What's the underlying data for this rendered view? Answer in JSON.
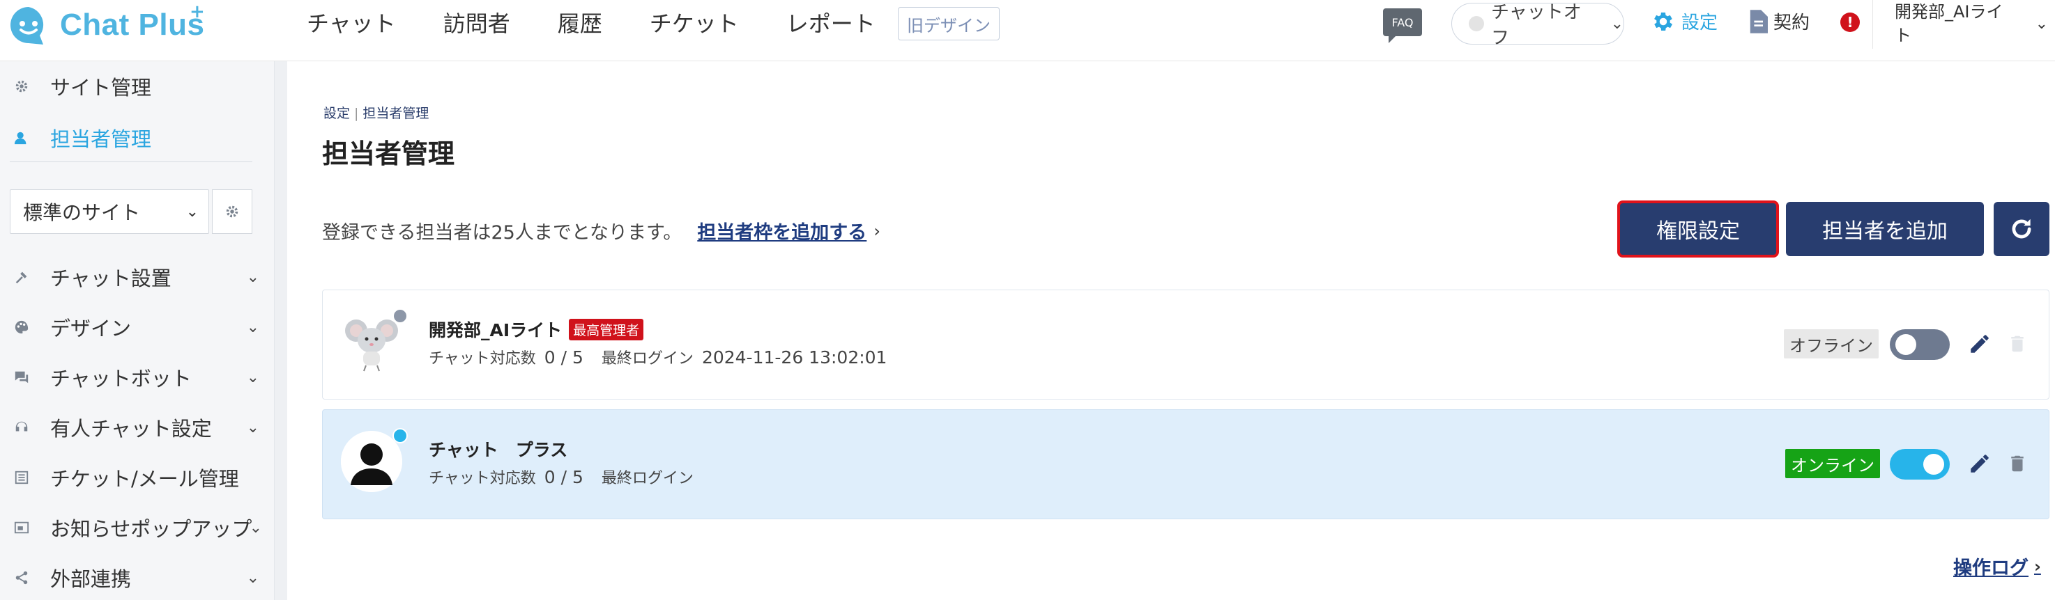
{
  "header": {
    "brand": "Chat Plus",
    "brand_sup": "+",
    "nav": [
      "チャット",
      "訪問者",
      "履歴",
      "チケット",
      "レポート"
    ],
    "old_design": "旧デザイン",
    "faq": "FAQ",
    "chat_status": "チャットオフ",
    "settings": "設定",
    "contract": "契約",
    "alert": "!",
    "user_line1": "開発部_AIライ",
    "user_line2": "ト"
  },
  "sidebar": {
    "top_items": [
      {
        "label": "サイト管理",
        "icon": "gear-icon"
      },
      {
        "label": "担当者管理",
        "icon": "person-icon"
      }
    ],
    "site_select": "標準のサイト",
    "menu": [
      {
        "label": "チャット設置",
        "icon": "tools-icon"
      },
      {
        "label": "デザイン",
        "icon": "palette-icon"
      },
      {
        "label": "チャットボット",
        "icon": "chat-bubbles-icon"
      },
      {
        "label": "有人チャット設定",
        "icon": "headset-icon"
      },
      {
        "label": "チケット/メール管理",
        "icon": "list-icon"
      },
      {
        "label": "お知らせポップアップ",
        "icon": "popup-icon"
      },
      {
        "label": "外部連携",
        "icon": "share-icon"
      }
    ]
  },
  "main": {
    "breadcrumb": [
      "設定",
      "担当者管理"
    ],
    "title": "担当者管理",
    "limit_text": "登録できる担当者は25人までとなります。",
    "add_slot_link": "担当者枠を追加する",
    "perm_button": "権限設定",
    "add_button": "担当者を追加",
    "operators": [
      {
        "name": "開発部_AIライト",
        "role": "最高管理者",
        "chat_label": "チャット対応数",
        "chat_count": "0 / 5",
        "login_label": "最終ログイン",
        "login_time": "2024-11-26 13:02:01",
        "status": "オフライン",
        "dot_color": "#8d97a8"
      },
      {
        "name": "チャット　プラス",
        "role": "",
        "chat_label": "チャット対応数",
        "chat_count": "0 / 5",
        "login_label": "最終ログイン",
        "login_time": "",
        "status": "オンライン",
        "dot_color": "#27b4ea"
      }
    ],
    "op_log": "操作ログ"
  },
  "colors": {
    "brand": "#4fb4e0",
    "primary_button": "#283d6f",
    "highlight": "#e0131b",
    "online": "#16a316",
    "admin_badge": "#d0121b"
  }
}
